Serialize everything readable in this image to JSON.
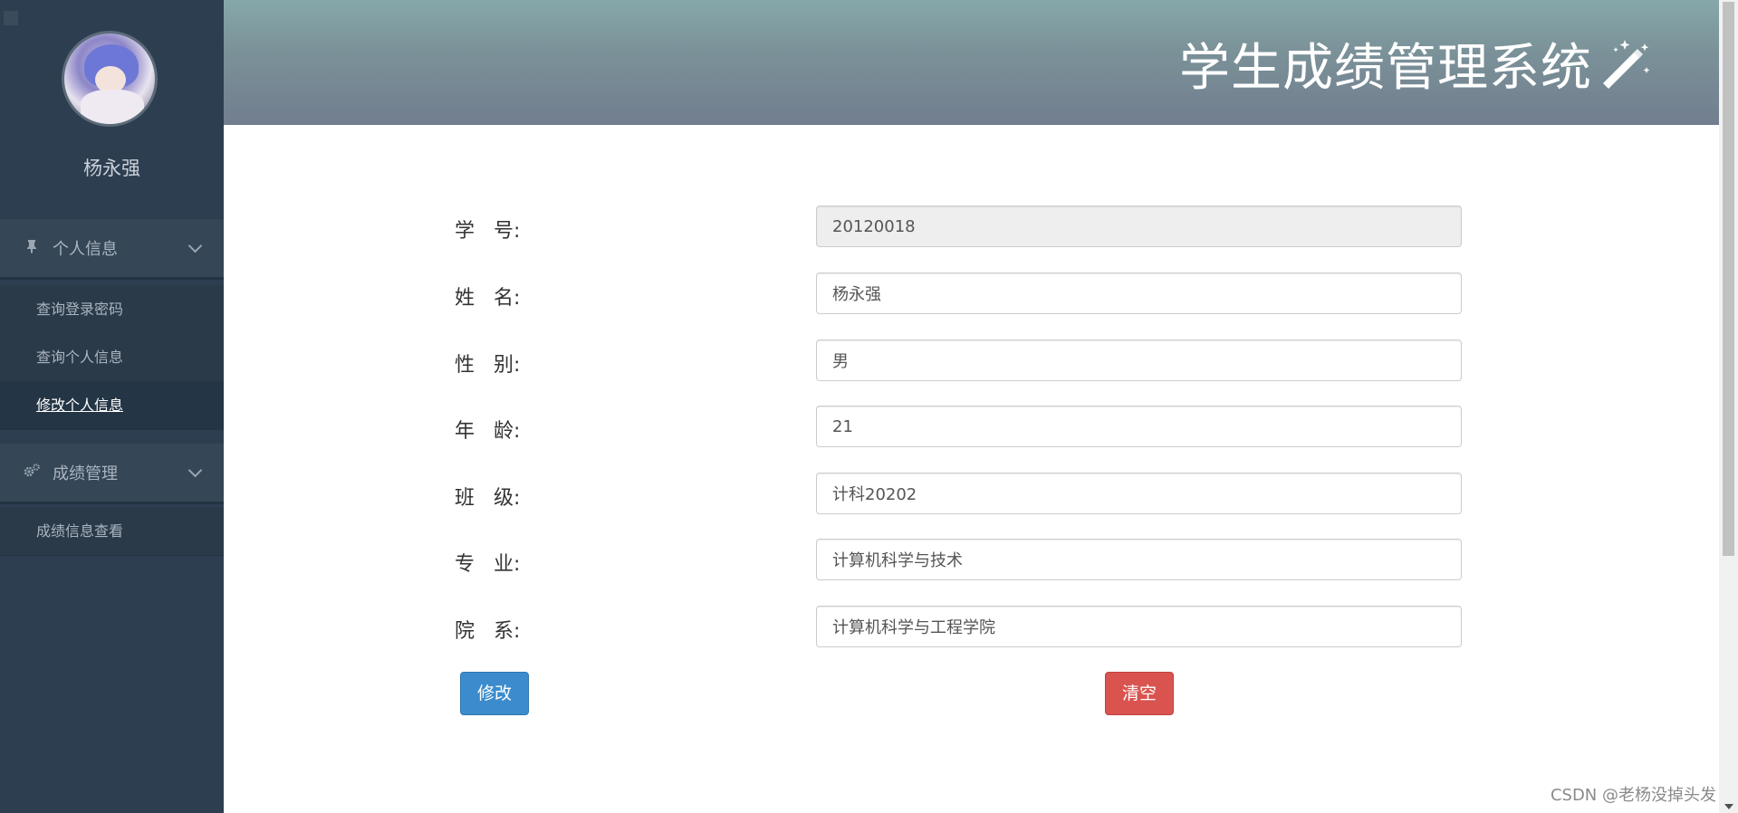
{
  "sidebar": {
    "username": "杨永强",
    "groups": [
      {
        "label": "个人信息",
        "icon": "pin-icon",
        "items": [
          {
            "label": "查询登录密码"
          },
          {
            "label": "查询个人信息"
          },
          {
            "label": "修改个人信息",
            "active": true
          }
        ]
      },
      {
        "label": "成绩管理",
        "icon": "gears-icon",
        "items": [
          {
            "label": "成绩信息查看"
          }
        ]
      }
    ]
  },
  "header": {
    "title": "学生成绩管理系统",
    "icon": "magic-wand-icon"
  },
  "form": {
    "fields": [
      {
        "label": "学   号:",
        "value": "20120018",
        "readonly": true
      },
      {
        "label": "姓   名:",
        "value": "杨永强"
      },
      {
        "label": "性   别:",
        "value": "男"
      },
      {
        "label": "年   龄:",
        "value": "21"
      },
      {
        "label": "班   级:",
        "value": "计科20202"
      },
      {
        "label": "专   业:",
        "value": "计算机科学与技术"
      },
      {
        "label": "院   系:",
        "value": "计算机科学与工程学院"
      }
    ],
    "submit_label": "修改",
    "clear_label": "清空"
  },
  "colors": {
    "sidebar_bg": "#2d3e50",
    "primary": "#3c8ccd",
    "danger": "#d9534f"
  },
  "watermark": "CSDN @老杨没掉头发"
}
